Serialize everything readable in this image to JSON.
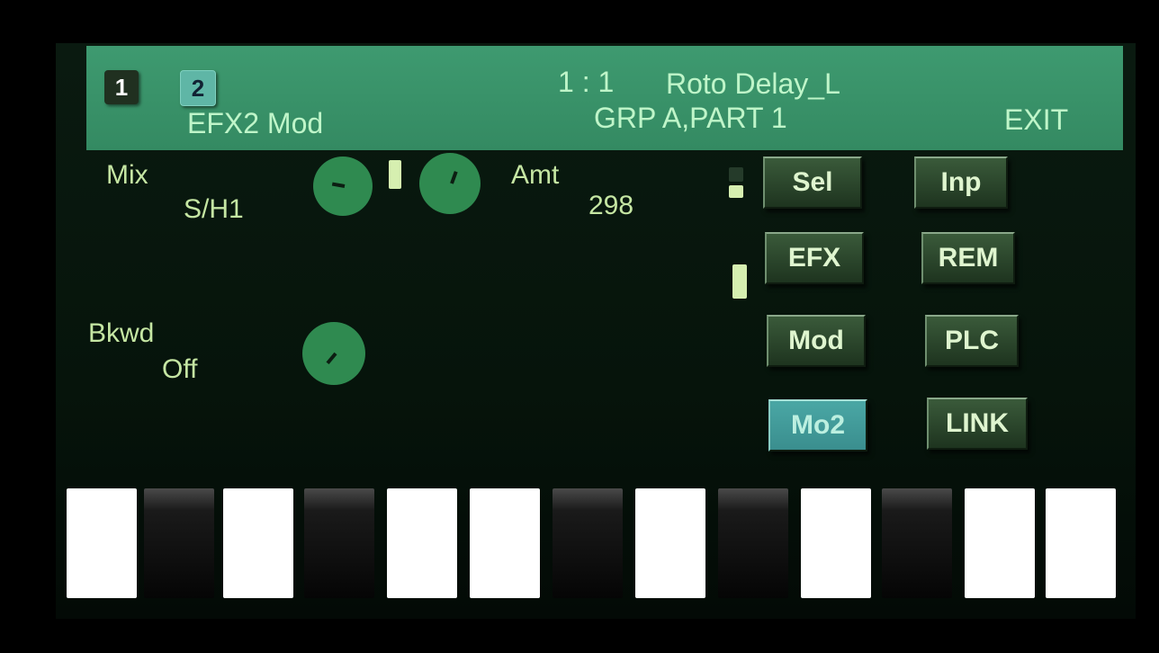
{
  "header": {
    "tab1": "1",
    "tab2": "2",
    "page_title": "EFX2 Mod",
    "position": "1 : 1",
    "preset_name": "Roto Delay_L",
    "group_part": "GRP A,PART 1",
    "exit_label": "EXIT"
  },
  "params": {
    "mix_label": "Mix",
    "mix_value": "S/H1",
    "amt_label": "Amt",
    "amt_value": "298",
    "bkwd_label": "Bkwd",
    "bkwd_value": "Off"
  },
  "buttons": {
    "sel": "Sel",
    "inp": "Inp",
    "efx": "EFX",
    "rem": "REM",
    "mod": "Mod",
    "plc": "PLC",
    "mo2": "Mo2",
    "link": "LINK"
  },
  "keyboard": {
    "keys": [
      "white",
      "black",
      "white",
      "black",
      "white",
      "white",
      "black",
      "white",
      "black",
      "white",
      "black",
      "white",
      "white"
    ]
  },
  "colors": {
    "header_green": "#3e9a70",
    "knob_green": "#2f8a50",
    "label_text": "#c5e6a3",
    "active_button": "#4aa7a5"
  }
}
